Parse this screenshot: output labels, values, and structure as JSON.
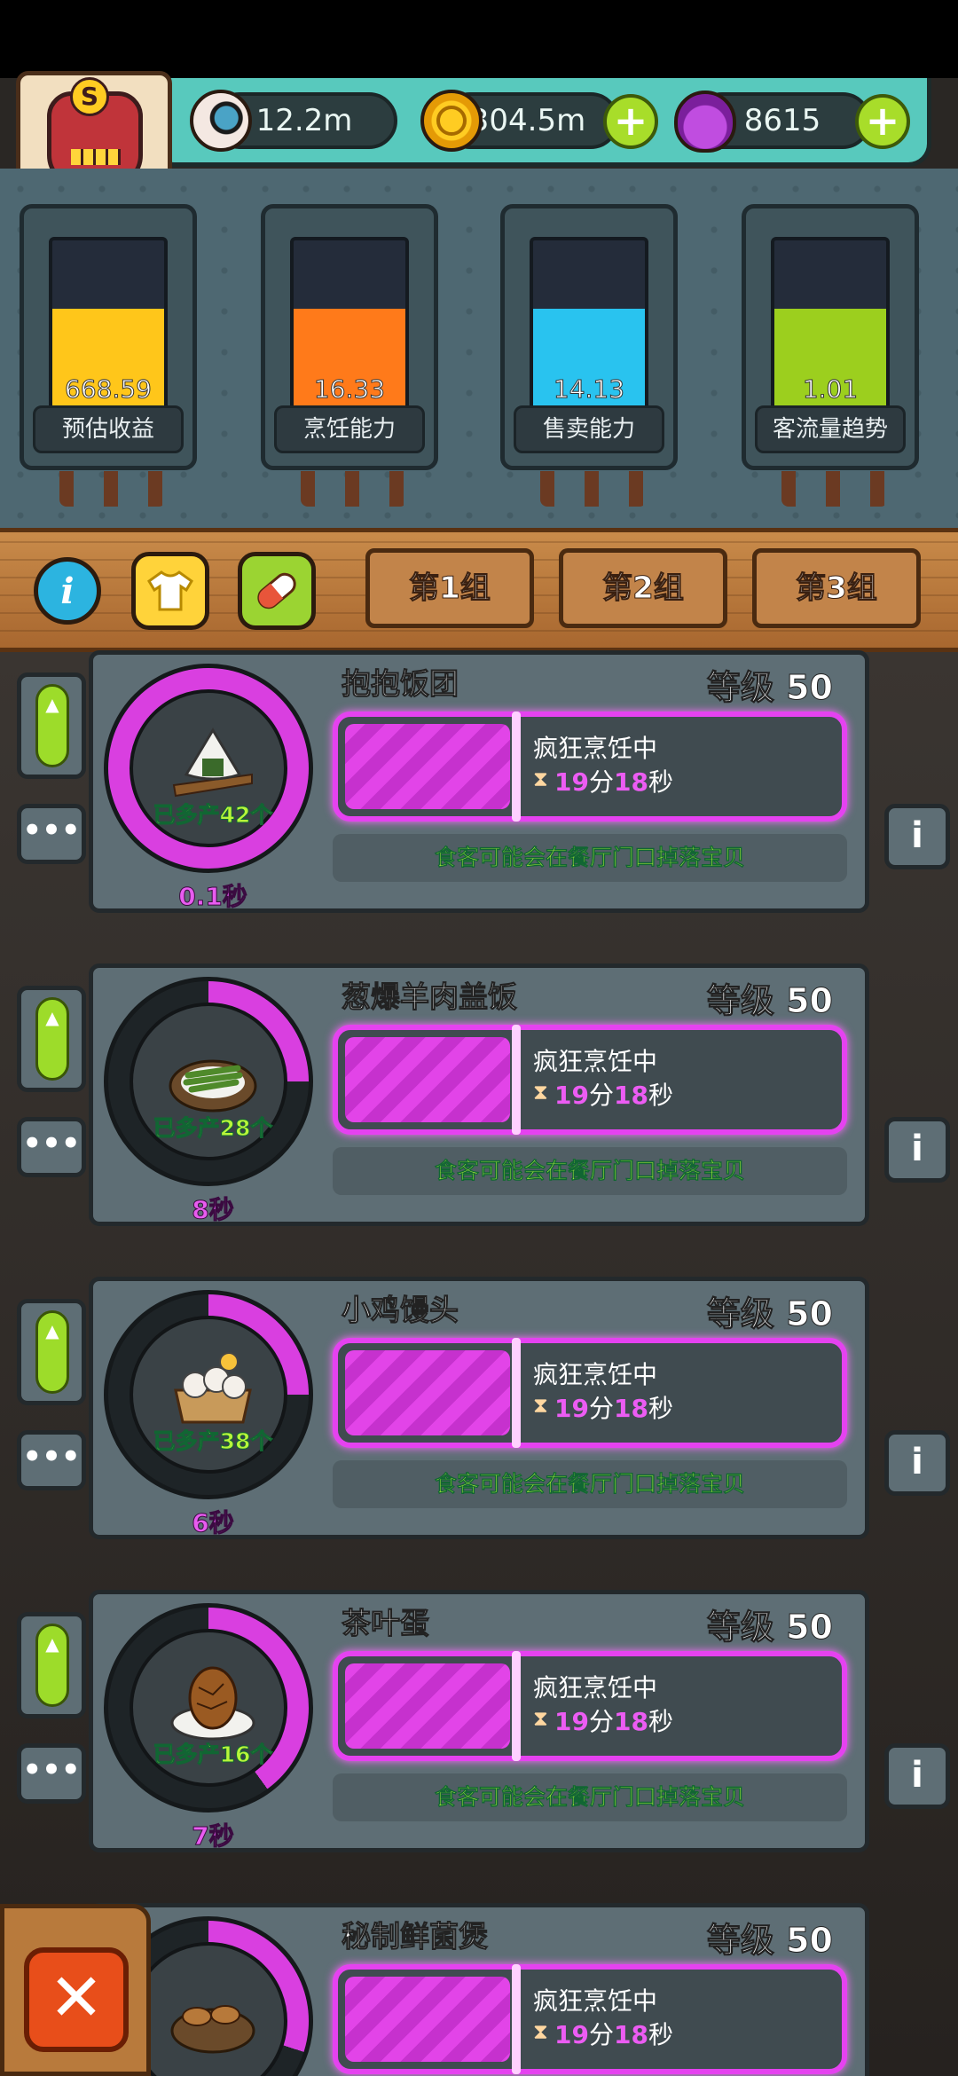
{
  "resources": {
    "eyes": "12.2m",
    "coins": "304.5m",
    "potions": "8615",
    "add_label": "+"
  },
  "avatar": {
    "letter": "S"
  },
  "stats": [
    {
      "value": "668.59",
      "label": "预估收益",
      "color": "#ffc61a",
      "fill_percent": 60
    },
    {
      "value": "16.33",
      "label": "烹饪能力",
      "color": "#ff7a1a",
      "fill_percent": 60
    },
    {
      "value": "14.13",
      "label": "售卖能力",
      "color": "#29c3ef",
      "fill_percent": 60
    },
    {
      "value": "1.01",
      "label": "客流量趋势",
      "color": "#9ccf1e",
      "fill_percent": 60
    }
  ],
  "toolbar": {
    "info_icon": "info-icon",
    "shirt_icon": "shirt-icon",
    "capsule_icon": "capsule-icon",
    "groups": [
      "第1组",
      "第2组",
      "第3组"
    ]
  },
  "recipes": [
    {
      "name": "抱抱饭团",
      "level": "等级 50",
      "produced": "已多产42个",
      "time": "0.1秒",
      "ring_percent": 100,
      "food": "rice-ball-icon",
      "status": "疯狂烹饪中",
      "minutes": "19",
      "min_unit": "分",
      "seconds": "18",
      "sec_unit": "秒",
      "tip": "食客可能会在餐厅门口掉落宝贝"
    },
    {
      "name": "葱爆羊肉盖饭",
      "level": "等级 50",
      "produced": "已多产28个",
      "time": "8秒",
      "ring_percent": 25,
      "food": "lamb-rice-icon",
      "status": "疯狂烹饪中",
      "minutes": "19",
      "min_unit": "分",
      "seconds": "18",
      "sec_unit": "秒",
      "tip": "食客可能会在餐厅门口掉落宝贝"
    },
    {
      "name": "小鸡馒头",
      "level": "等级 50",
      "produced": "已多产38个",
      "time": "6秒",
      "ring_percent": 25,
      "food": "chick-bun-icon",
      "status": "疯狂烹饪中",
      "minutes": "19",
      "min_unit": "分",
      "seconds": "18",
      "sec_unit": "秒",
      "tip": "食客可能会在餐厅门口掉落宝贝"
    },
    {
      "name": "茶叶蛋",
      "level": "等级 50",
      "produced": "已多产16个",
      "time": "7秒",
      "ring_percent": 40,
      "food": "tea-egg-icon",
      "status": "疯狂烹饪中",
      "minutes": "19",
      "min_unit": "分",
      "seconds": "18",
      "sec_unit": "秒",
      "tip": "食客可能会在餐厅门口掉落宝贝"
    },
    {
      "name": "秘制鲜菌煲",
      "level": "等级 50",
      "produced": "",
      "time": "",
      "ring_percent": 30,
      "food": "mushroom-pot-icon",
      "status": "疯狂烹饪中",
      "minutes": "19",
      "min_unit": "分",
      "seconds": "18",
      "sec_unit": "秒",
      "tip": ""
    }
  ],
  "close_label": "✕"
}
